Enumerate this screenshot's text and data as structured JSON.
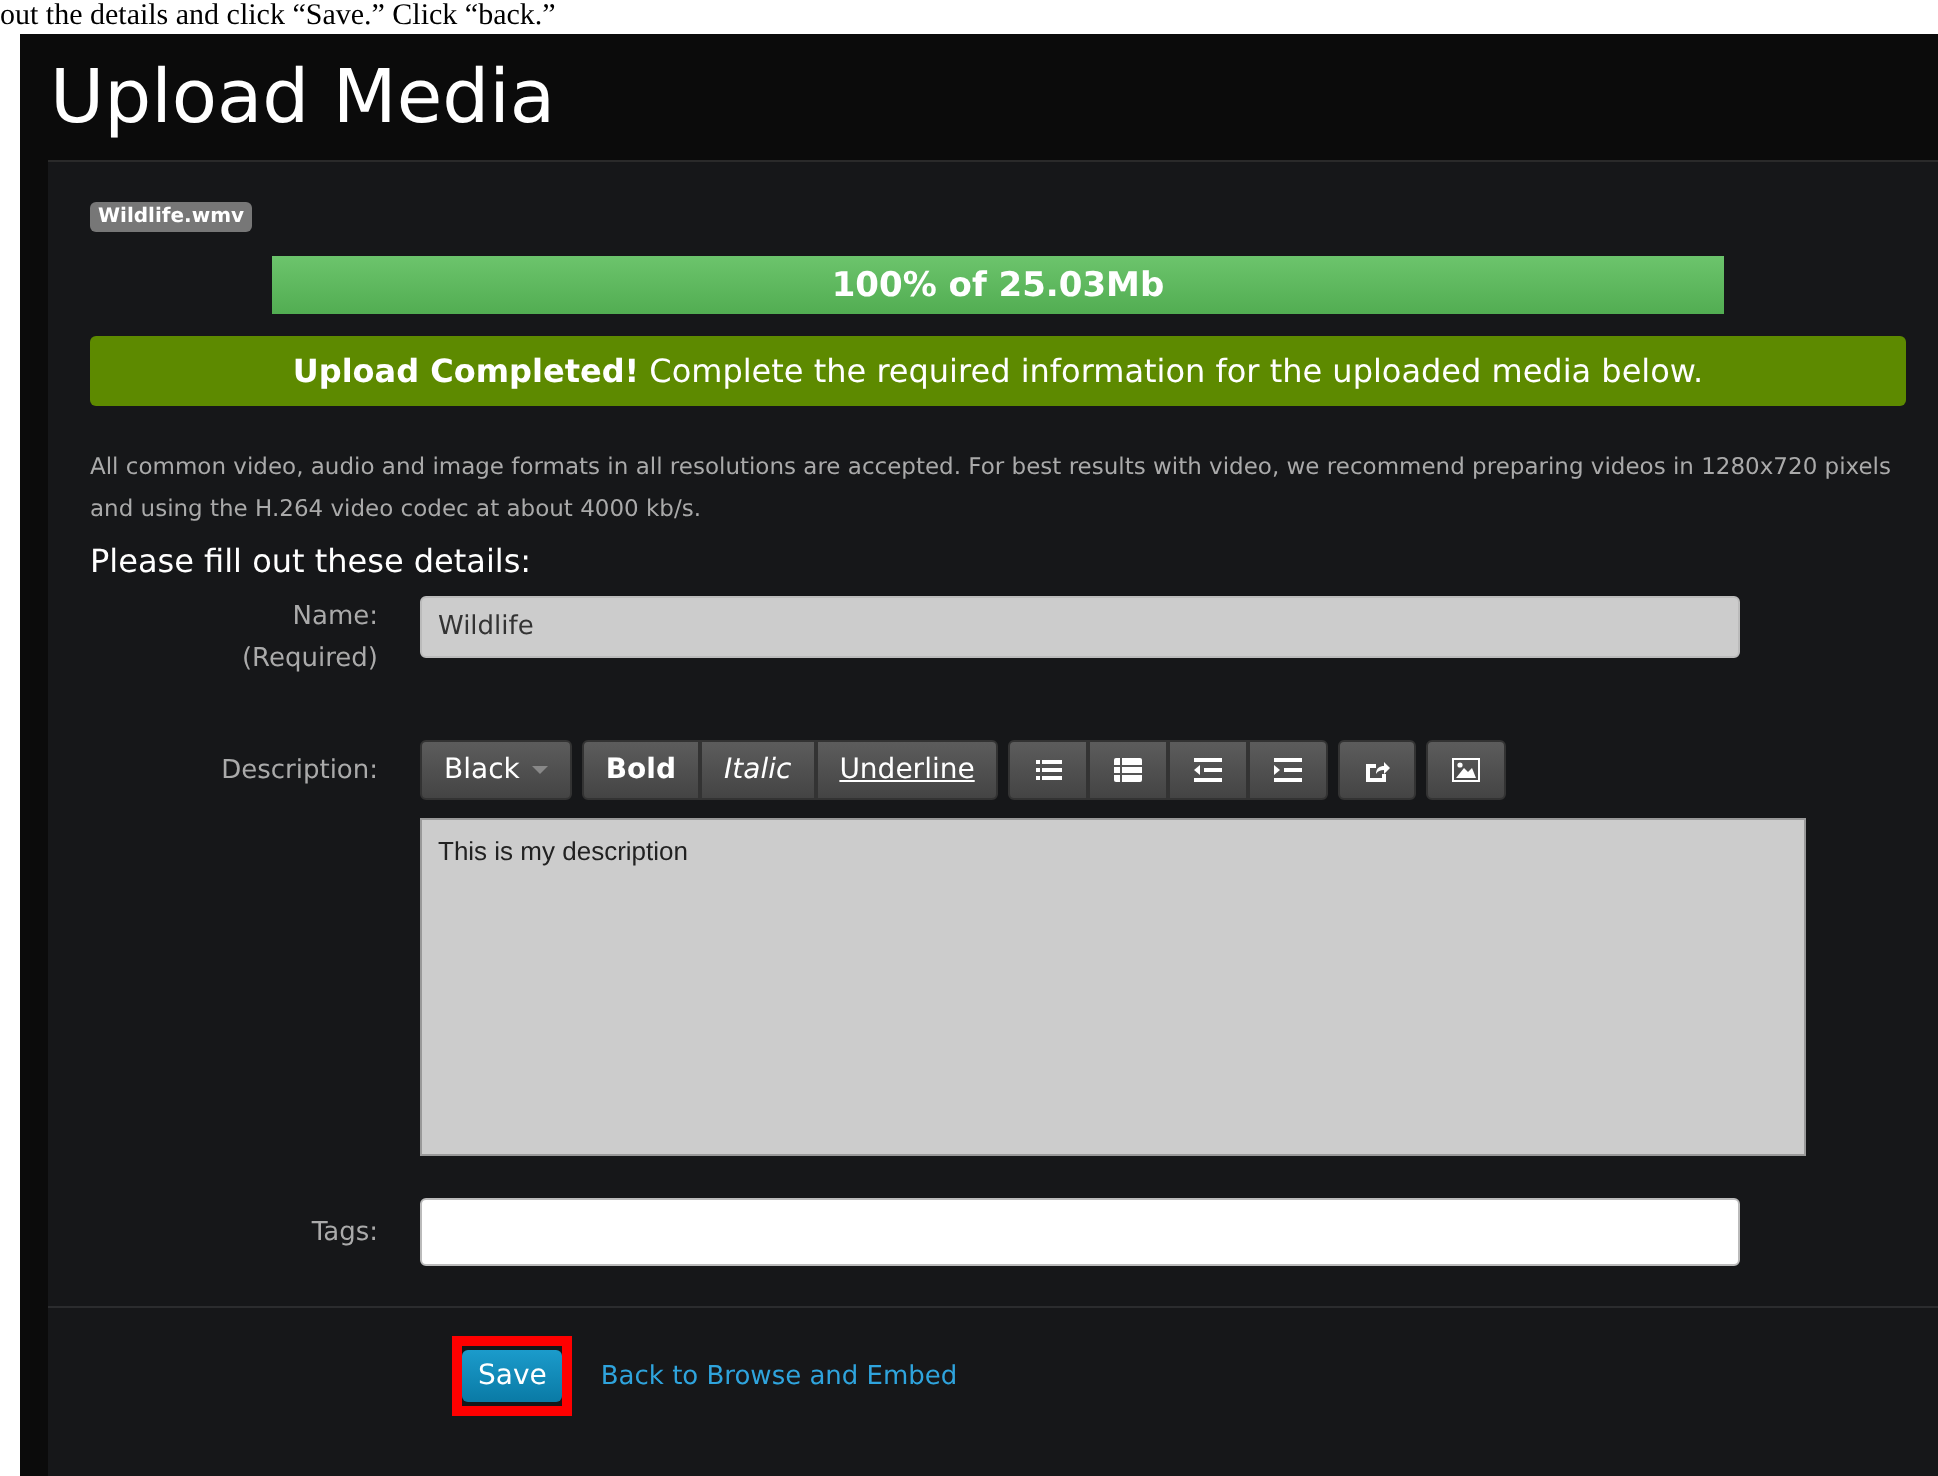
{
  "caption": "out the details and click “Save.” Click “back.”",
  "page": {
    "title": "Upload Media"
  },
  "file_tag": "Wildlife.wmv",
  "progress": {
    "level": 1,
    "label": "100% of 25.03Mb"
  },
  "alert": {
    "text": "**Upload Completed!** Complete the required information for the uploaded media below."
  },
  "info": "All common video, audio and image formats in all resolutions are accepted.  For best results with video, we recommend preparing videos in 1280x720 pixels and using the H.264 video codec at about 4000 kb/s.",
  "form_heading": "Please fill out these details:",
  "name_field": {
    "label": "Name:",
    "note": "(Required)",
    "value": "Wildlife"
  },
  "description": {
    "label": "Description:",
    "toolbar": [
      [
        {
          "kind": "dropdown",
          "label": "Black"
        }
      ],
      [
        {
          "kind": "bold",
          "label": "Bold"
        },
        {
          "kind": "italic",
          "label": "Italic"
        },
        {
          "kind": "underline",
          "label": "Underline"
        }
      ],
      [
        {
          "kind": "bullets"
        },
        {
          "kind": "numbers"
        },
        {
          "kind": "outdent"
        },
        {
          "kind": "indent"
        }
      ],
      [
        {
          "kind": "link"
        }
      ],
      [
        {
          "kind": "image"
        }
      ]
    ],
    "value": "This is my description"
  },
  "tags": {
    "label": "Tags:"
  },
  "save": {
    "label": "Save",
    "highlighted": true
  },
  "back_link": "Back to Browse and Embed"
}
